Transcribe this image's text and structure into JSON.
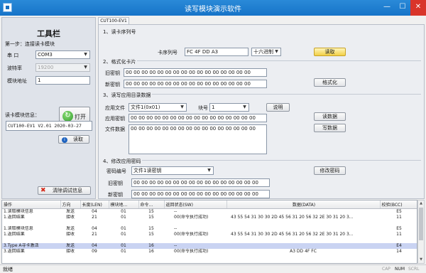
{
  "window": {
    "title": "读写模块演示软件",
    "min": "—",
    "max": "☐",
    "close": "✕"
  },
  "toolbar": {
    "title": "工具栏",
    "step1": "第一步：连接读卡模块",
    "port_label": "串 口",
    "port_value": "COM3",
    "baud_label": "波特率",
    "baud_value": "19200",
    "addr_label": "模块地址",
    "addr_value": "1",
    "open_button": "打开",
    "info_label": "读卡模块信息：",
    "info_value": "CUT100-EV1 V2.01 2020-03-27",
    "read_button": "读取",
    "clear_button": "清除调试信息"
  },
  "tab": {
    "label": "CUT100-EV1"
  },
  "section1": {
    "title": "1、读卡序列号",
    "serial_label": "卡序列号",
    "serial_value": "FC 4F DD A3",
    "format_value": "十六进制",
    "read_button": "读取"
  },
  "section2": {
    "title": "2、格式化卡片",
    "old_key_label": "旧密钥",
    "old_key_value": "00 00 00 00 00 00 00 00 00 00 00 00 00 00 00 00",
    "new_key_label": "新密钥",
    "new_key_value": "00 00 00 00 00 00 00 00 00 00 00 00 00 00 00 00",
    "format_button": "格式化"
  },
  "section3": {
    "title": "3、读写应用目录数据",
    "file_label": "应用文件",
    "file_value": "文件1(0x01)",
    "block_label": "块号",
    "block_value": "1",
    "help_button": "说明",
    "key_label": "应用密钥",
    "key_value": "00 00 00 00 00 00 00 00 00 00 00 00 00 00 00 00",
    "data_label": "文件数据",
    "data_value": "00 00 00 00 00 00 00 00 00 00 00 00 00 00 00 00",
    "read_button": "读数据",
    "write_button": "写数据"
  },
  "section4": {
    "title": "4、修改应用密码",
    "key_no_label": "密码编号",
    "key_no_value": "文件1读密钥",
    "old_label": "旧密钥",
    "old_value": "00 00 00 00 00 00 00 00 00 00 00 00 00 00 00 00",
    "new_label": "新密钥",
    "new_value": "00 00 00 00 00 00 00 00 00 00 00 00 00 00 00 00",
    "modify_button": "修改密码"
  },
  "log": {
    "columns": [
      "操作",
      "方向",
      "长度(LEN)",
      "模块地...",
      "命令...",
      "返回状态(SW)",
      "数据(DATA)",
      "校验(BCC)"
    ],
    "rows": [
      [
        "1.读取模块信息",
        "发送",
        "04",
        "01",
        "15",
        "--",
        "",
        "E5"
      ],
      [
        "1.返回结果",
        "接收",
        "21",
        "01",
        "15",
        "00(命令执行成功)",
        "43 55 54 31 30 30 2D 45 56 31 20 56 32 2E 30 31 20 3...",
        "11"
      ],
      [
        "",
        "",
        "",
        "",
        "",
        "",
        "",
        ""
      ],
      [
        "1.读取模块信息",
        "发送",
        "04",
        "01",
        "15",
        "--",
        "",
        "E5"
      ],
      [
        "1.返回结果",
        "接收",
        "21",
        "01",
        "15",
        "00(命令执行成功)",
        "43 55 54 31 30 30 2D 45 56 31 20 56 32 2E 30 31 20 3...",
        "11"
      ],
      [
        "",
        "",
        "",
        "",
        "",
        "",
        "",
        ""
      ],
      [
        "3.Type A寻卡激活",
        "发送",
        "04",
        "01",
        "16",
        "--",
        "",
        "E4"
      ],
      [
        "3.返回结果",
        "接收",
        "09",
        "01",
        "16",
        "00(命令执行成功)",
        "A3 DD 4F FC",
        "14"
      ]
    ],
    "highlight_row": 6
  },
  "status": {
    "text": "就绪",
    "cap": "CAP",
    "num": "NUM",
    "scrl": "SCRL"
  },
  "colors": {
    "titlebar": "#1673c8",
    "close": "#d9342a",
    "highlight": "#c9d3f2",
    "read_button": "#f2cf46"
  },
  "icons": [
    "app-icon",
    "refresh-icon",
    "info-icon",
    "clear-icon",
    "chevron-down-icon"
  ]
}
